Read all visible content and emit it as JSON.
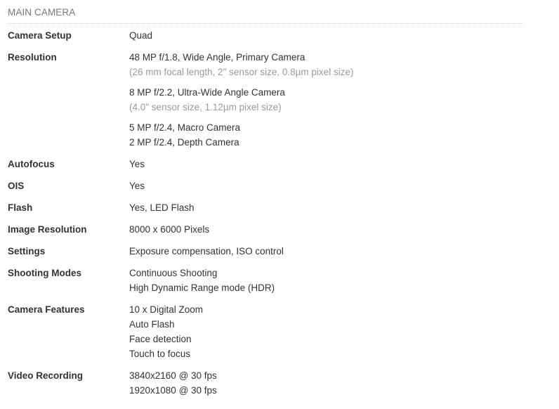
{
  "section": {
    "title": "MAIN CAMERA"
  },
  "rows": [
    {
      "label": "Camera Setup",
      "blocks": [
        {
          "lines": [
            {
              "text": "Quad"
            }
          ]
        }
      ]
    },
    {
      "label": "Resolution",
      "blocks": [
        {
          "lines": [
            {
              "text": "48 MP f/1.8, Wide Angle, Primary Camera"
            },
            {
              "text": "(26 mm focal length, 2\" sensor size, 0.8µm pixel size)",
              "muted": true
            }
          ]
        },
        {
          "lines": [
            {
              "text": "8 MP f/2.2, Ultra-Wide Angle Camera"
            },
            {
              "text": "(4.0\" sensor size, 1.12µm pixel size)",
              "muted": true
            }
          ]
        },
        {
          "lines": [
            {
              "text": "5 MP f/2.4, Macro Camera"
            },
            {
              "text": "2 MP f/2.4, Depth Camera"
            }
          ]
        }
      ]
    },
    {
      "label": "Autofocus",
      "blocks": [
        {
          "lines": [
            {
              "text": "Yes"
            }
          ]
        }
      ]
    },
    {
      "label": "OIS",
      "blocks": [
        {
          "lines": [
            {
              "text": "Yes"
            }
          ]
        }
      ]
    },
    {
      "label": "Flash",
      "blocks": [
        {
          "lines": [
            {
              "text": "Yes, LED Flash"
            }
          ]
        }
      ]
    },
    {
      "label": "Image Resolution",
      "blocks": [
        {
          "lines": [
            {
              "text": "8000 x 6000 Pixels"
            }
          ]
        }
      ]
    },
    {
      "label": "Settings",
      "blocks": [
        {
          "lines": [
            {
              "text": "Exposure compensation, ISO control"
            }
          ]
        }
      ]
    },
    {
      "label": "Shooting Modes",
      "blocks": [
        {
          "lines": [
            {
              "text": "Continuous Shooting"
            },
            {
              "text": "High Dynamic Range mode (HDR)"
            }
          ]
        }
      ]
    },
    {
      "label": "Camera Features",
      "blocks": [
        {
          "lines": [
            {
              "text": "10 x Digital Zoom"
            },
            {
              "text": "Auto Flash"
            },
            {
              "text": "Face detection"
            },
            {
              "text": "Touch to focus"
            }
          ]
        }
      ]
    },
    {
      "label": "Video Recording",
      "blocks": [
        {
          "lines": [
            {
              "text": "3840x2160 @ 30 fps"
            },
            {
              "text": "1920x1080 @ 30 fps"
            }
          ]
        }
      ]
    }
  ]
}
